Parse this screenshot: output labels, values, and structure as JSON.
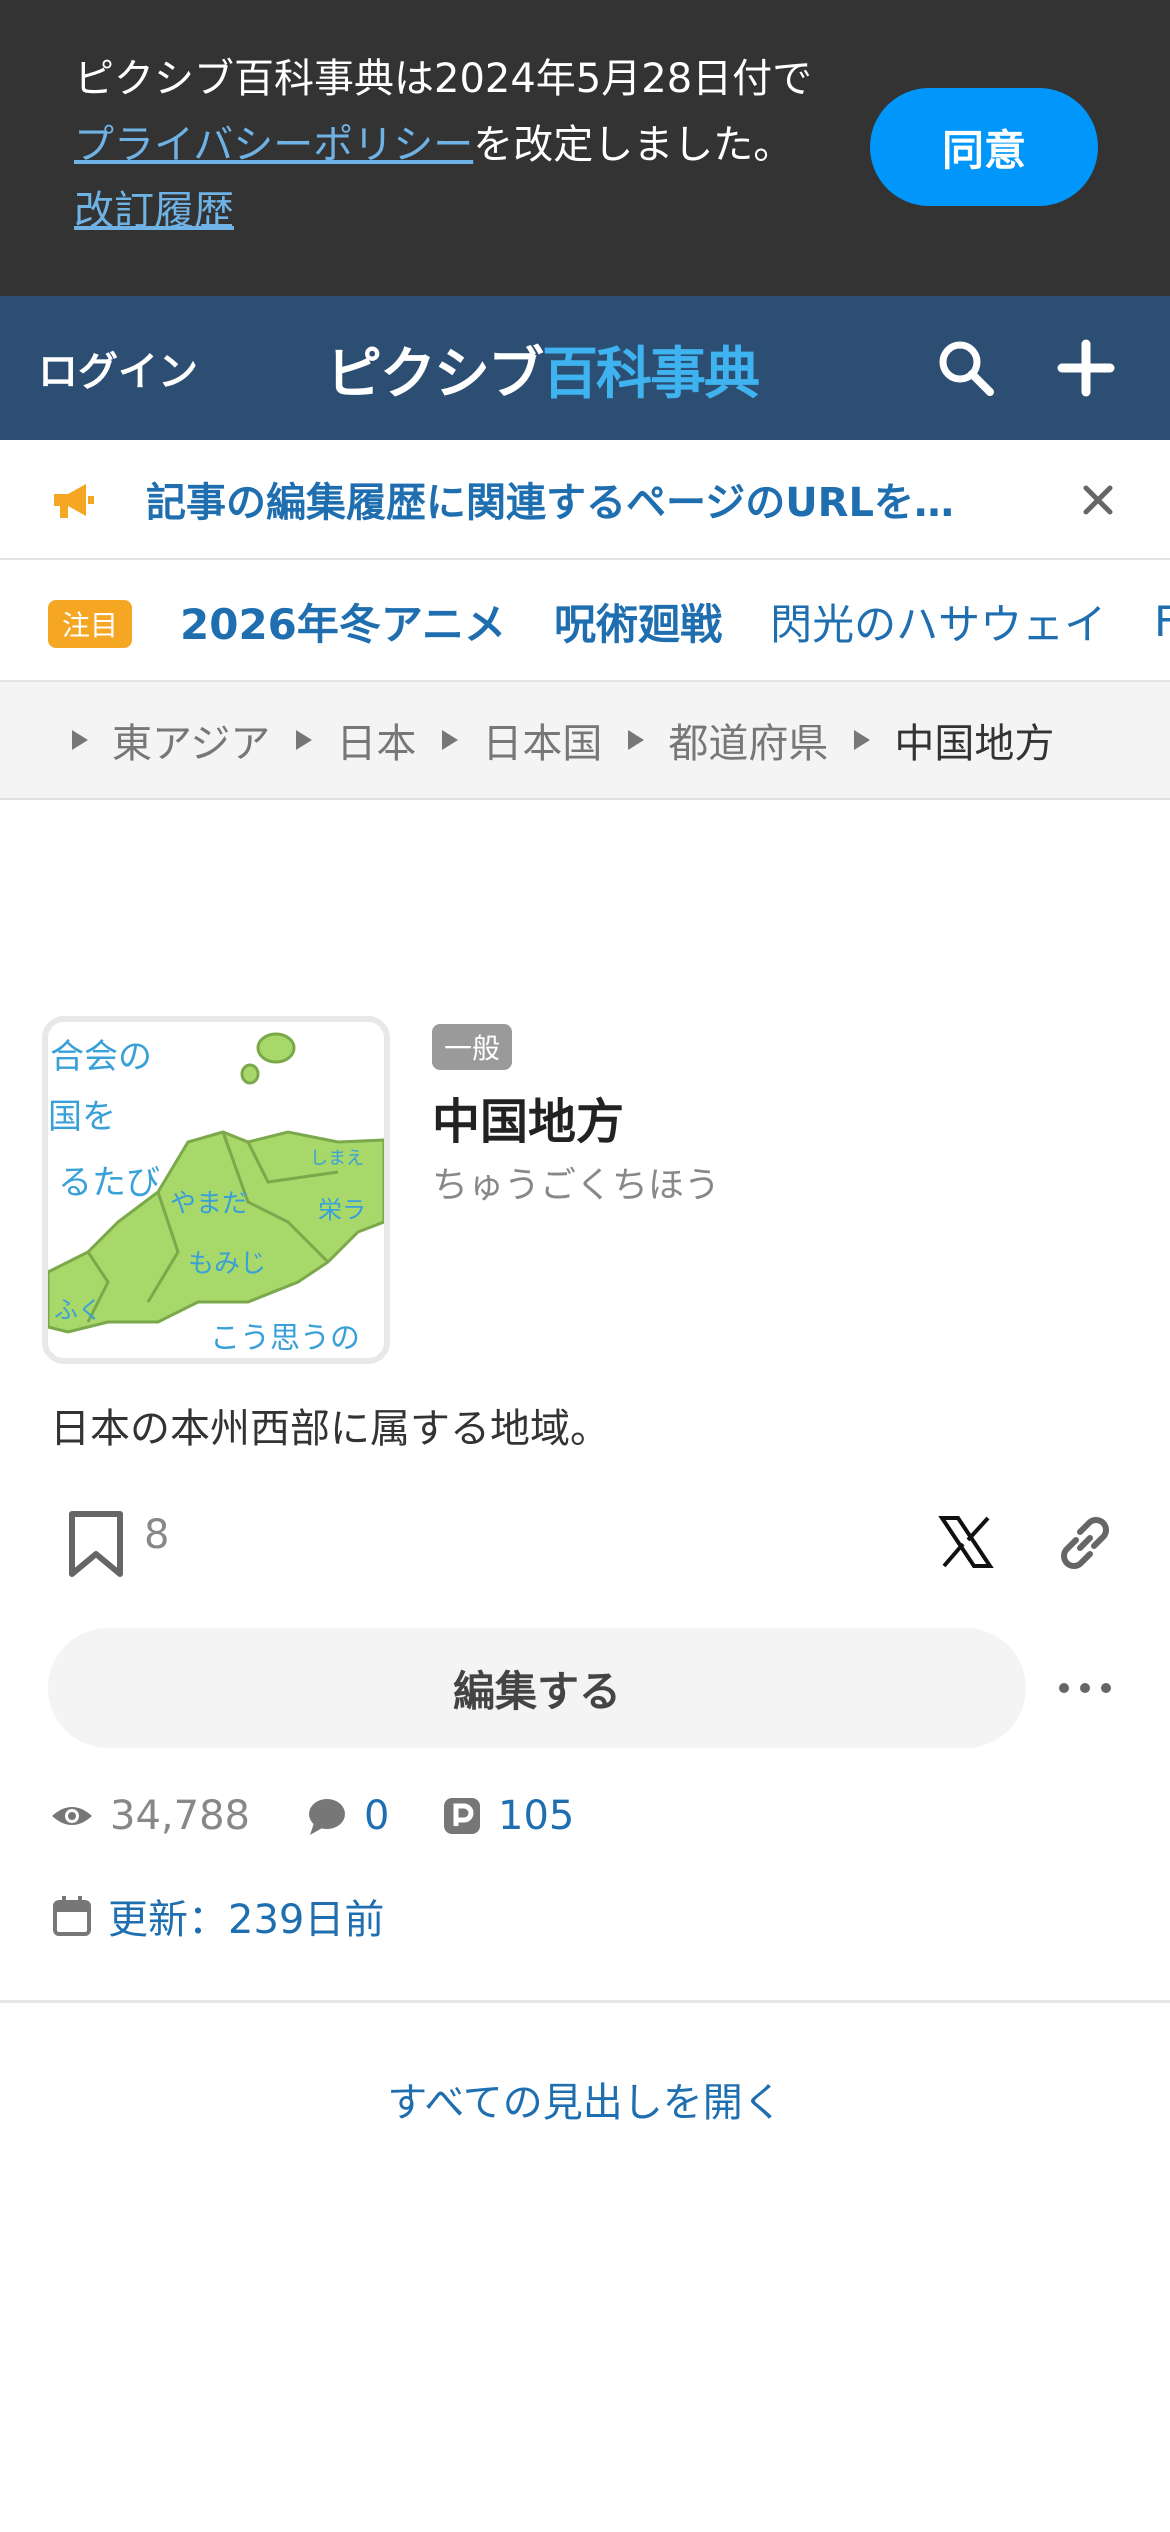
{
  "consent": {
    "text_before": "ピクシブ百科事典は2024年5月28日付で",
    "privacy_link": "プライバシーポリシー",
    "text_middle": "を改定しました。",
    "history_link": "改訂履歴",
    "agree_button": "同意"
  },
  "header": {
    "login": "ログイン",
    "logo_part1": "ピクシブ",
    "logo_part2": "百科事典",
    "search_icon": "search-icon",
    "add_icon": "plus-icon"
  },
  "notice": {
    "text": "記事の編集履歴に関連するページのURLを…",
    "icon": "megaphone-icon"
  },
  "trending": {
    "badge": "注目",
    "items": [
      "2026年冬アニメ",
      "呪術廻戦",
      "閃光のハサウェイ",
      "F"
    ]
  },
  "breadcrumb": [
    "東アジア",
    "日本",
    "日本国",
    "都道府県",
    "中国地方"
  ],
  "article": {
    "category_badge": "一般",
    "title": "中国地方",
    "reading": "ちゅうごくちほう",
    "summary": "日本の本州西部に属する地域。",
    "bookmark_count": "8",
    "edit_button": "編集する",
    "views": "34,788",
    "comments": "0",
    "pixiv_count": "105",
    "updated": "更新：239日前"
  },
  "thumbnail": {
    "labels": [
      "合会の",
      "国を",
      "るたび",
      "やまだ",
      "もみじ",
      "ふく",
      "こう思うの",
      "しまえ",
      "栄ラ"
    ]
  },
  "open_all": "すべての見出しを開く",
  "colors": {
    "header_bg": "#2d4e73",
    "accent_blue": "#1f6fb0",
    "agree_blue": "#0096fa",
    "badge_orange": "#f5a623"
  }
}
